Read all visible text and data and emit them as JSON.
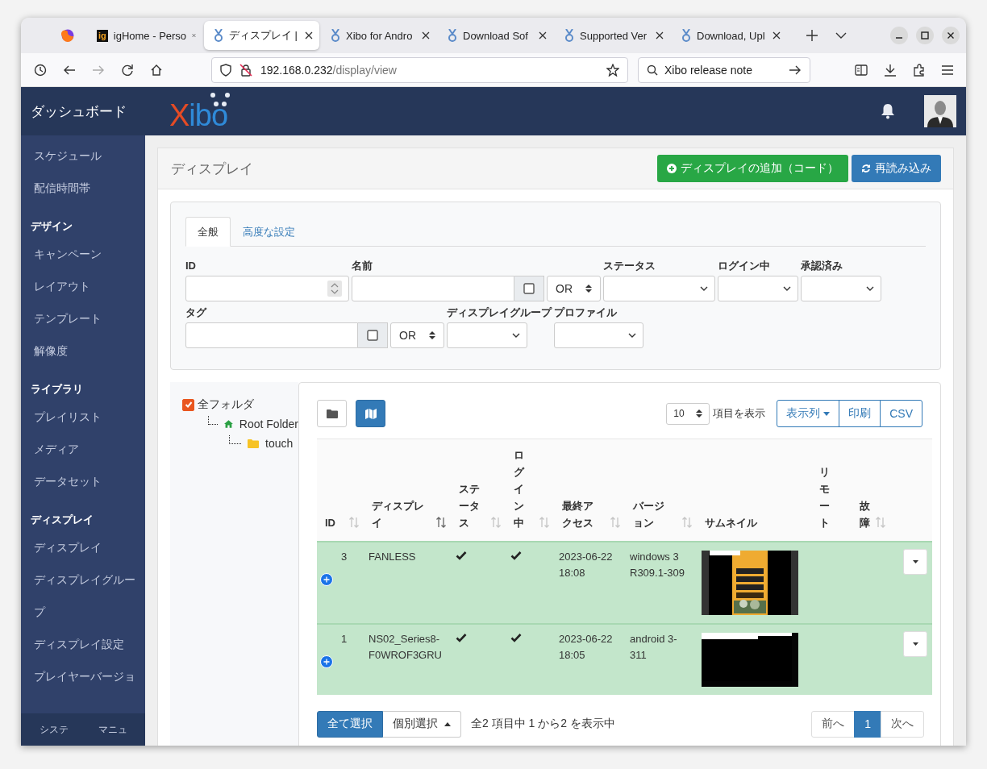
{
  "browser": {
    "tabs": [
      {
        "title": "igHome - Perso",
        "selected": false,
        "kind": "letters",
        "favicon_text": "ig"
      },
      {
        "title": "ディスプレイ |",
        "selected": true,
        "kind": "medal"
      },
      {
        "title": "Xibo for Andro",
        "selected": false,
        "kind": "medal"
      },
      {
        "title": "Download Sof",
        "selected": false,
        "kind": "medal"
      },
      {
        "title": "Supported Ver",
        "selected": false,
        "kind": "medal"
      },
      {
        "title": "Download, Upl",
        "selected": false,
        "kind": "medal"
      }
    ],
    "address": {
      "host": "192.168.0.232",
      "path": "/display/view"
    },
    "search": {
      "value": "Xibo release note"
    }
  },
  "header": {
    "logo": "Xibo"
  },
  "sidebar": {
    "title": "ダッシュボード",
    "items": [
      {
        "label": "スケジュール",
        "kind": "link"
      },
      {
        "label": "配信時間帯",
        "kind": "link"
      },
      {
        "label": "デザイン",
        "kind": "heading"
      },
      {
        "label": "キャンペーン",
        "kind": "link"
      },
      {
        "label": "レイアウト",
        "kind": "link"
      },
      {
        "label": "テンプレート",
        "kind": "link"
      },
      {
        "label": "解像度",
        "kind": "link"
      },
      {
        "label": "ライブラリ",
        "kind": "heading"
      },
      {
        "label": "プレイリスト",
        "kind": "link"
      },
      {
        "label": "メディア",
        "kind": "link"
      },
      {
        "label": "データセット",
        "kind": "link"
      },
      {
        "label": "ディスプレイ",
        "kind": "heading"
      },
      {
        "label": "ディスプレイ",
        "kind": "link"
      },
      {
        "label": "ディスプレイグループ",
        "kind": "link"
      },
      {
        "label": "ディスプレイ設定",
        "kind": "link"
      },
      {
        "label": "プレイヤーバージョ",
        "kind": "link"
      }
    ],
    "footer": [
      "システ",
      "マニュ"
    ]
  },
  "page": {
    "title": "ディスプレイ",
    "buttons": [
      {
        "label": "ディスプレイの追加（コード）",
        "kind": "add"
      },
      {
        "label": "再読み込み",
        "kind": "refresh"
      }
    ]
  },
  "filter": {
    "tabs": [
      {
        "label": "全般",
        "selected": true
      },
      {
        "label": "高度な設定",
        "selected": false
      }
    ],
    "rows": [
      [
        {
          "label": "ID",
          "kind": "number"
        },
        {
          "label": "名前",
          "kind": "text-or",
          "checked": false,
          "operator": "OR"
        },
        {
          "label": "ステータス",
          "kind": "select"
        },
        {
          "label": "ログイン中",
          "kind": "select"
        },
        {
          "label": "承認済み",
          "kind": "select"
        }
      ],
      [
        {
          "label": "タグ",
          "kind": "text-or",
          "checked": false,
          "operator": "OR"
        },
        {
          "label": "ディスプレイグループ",
          "kind": "select"
        },
        {
          "label": "プロファイル",
          "kind": "select"
        }
      ]
    ]
  },
  "folders": {
    "label": "全フォルダ",
    "checked": true,
    "children": [
      {
        "label": "Root Folder",
        "kind": "home",
        "children": [
          {
            "label": "touch",
            "kind": "folder"
          }
        ]
      }
    ]
  },
  "table": {
    "view_buttons": [
      {
        "kind": "folder",
        "selected": false
      },
      {
        "kind": "map",
        "selected": true
      }
    ],
    "page_size": "10",
    "page_size_label": "項目を表示",
    "buttons": [
      {
        "label": "表示列",
        "caret": true
      },
      {
        "label": "印刷",
        "caret": false
      },
      {
        "label": "CSV",
        "caret": false
      }
    ],
    "columns": [
      {
        "label": "ID",
        "sortable": true,
        "sorted": false
      },
      {
        "label": "ディスプレイ",
        "sortable": true,
        "sorted": true
      },
      {
        "label": "ステータス",
        "sortable": true,
        "sorted": false
      },
      {
        "label": "ログイン中",
        "sortable": true,
        "sorted": false
      },
      {
        "label": "最終アクセス",
        "sortable": true,
        "sorted": false
      },
      {
        "label": "バージョン",
        "sortable": true,
        "sorted": false
      },
      {
        "label": "サムネイル",
        "sortable": false
      },
      {
        "label": "リモート",
        "sortable": false
      },
      {
        "label": "故障",
        "sortable": true,
        "sorted": false
      }
    ],
    "rows": [
      {
        "id": "3",
        "display": "FANLESS",
        "status": true,
        "logged_in": true,
        "last_access": "2023-06-22 18:08",
        "version": "windows 3 R309.1-309",
        "selected": true
      },
      {
        "id": "1",
        "display": "NS02_Series8-F0WROF3GRU",
        "status": true,
        "logged_in": true,
        "last_access": "2023-06-22 18:05",
        "version": "android 3-311",
        "selected": true
      }
    ],
    "footer": {
      "select_all": "全て選択",
      "select_mode": "個別選択",
      "info": "全2 項目中 1 から2 を表示中",
      "pages": [
        {
          "label": "前へ",
          "selected": false
        },
        {
          "label": "1",
          "selected": true
        },
        {
          "label": "次へ",
          "selected": false
        }
      ]
    }
  }
}
